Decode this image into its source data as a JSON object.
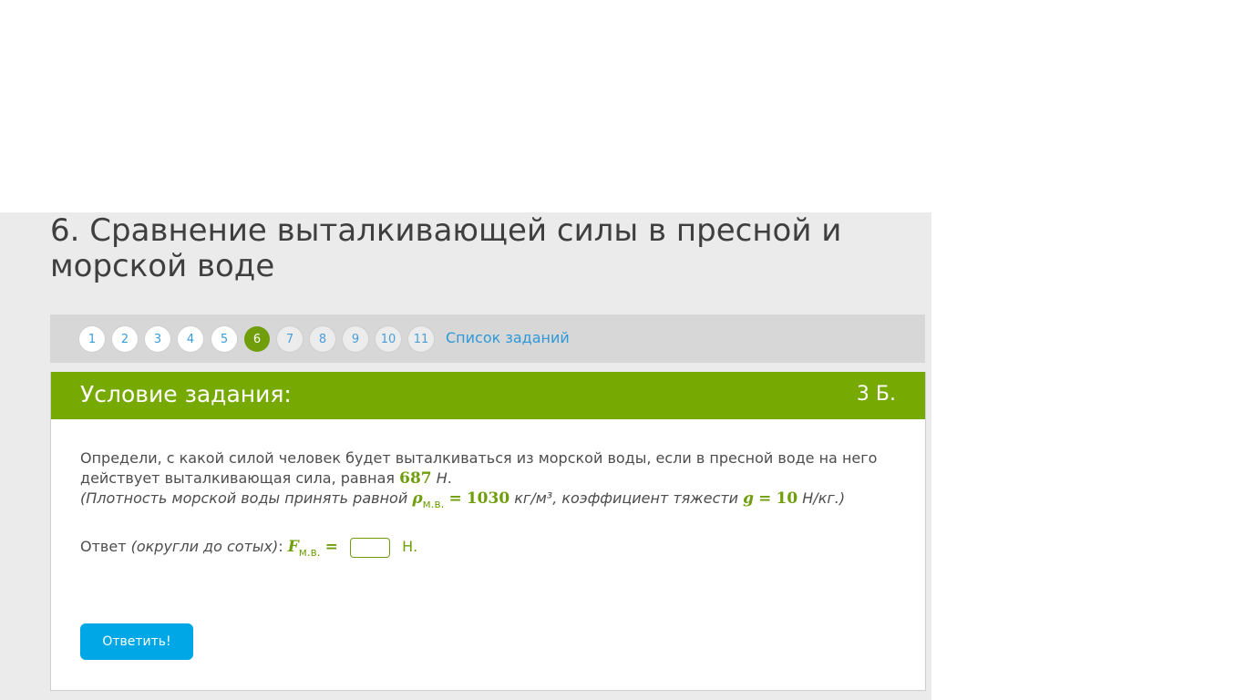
{
  "task": {
    "title": "6. Сравнение выталкивающей силы в пресной и морской воде"
  },
  "nav": {
    "items": [
      {
        "label": "1",
        "state": "done"
      },
      {
        "label": "2",
        "state": "done"
      },
      {
        "label": "3",
        "state": "done"
      },
      {
        "label": "4",
        "state": "done"
      },
      {
        "label": "5",
        "state": "done"
      },
      {
        "label": "6",
        "state": "active"
      },
      {
        "label": "7",
        "state": "future"
      },
      {
        "label": "8",
        "state": "future"
      },
      {
        "label": "9",
        "state": "future"
      },
      {
        "label": "10",
        "state": "future"
      },
      {
        "label": "11",
        "state": "future"
      }
    ],
    "list_link": "Список заданий"
  },
  "card": {
    "header_title": "Условие задания:",
    "points": "3 Б.",
    "problem_text": "Определи, с какой силой человек будет выталкиваться из морской воды, если в пресной воде на него действует выталкивающая сила, равная",
    "force_value": "687",
    "force_unit": "Н",
    "period": ".",
    "hint_open": "(Плотность морской воды принять равной",
    "rho_symbol": "ρ",
    "rho_sub": "м.в.",
    "equals": "=",
    "rho_value": "1030",
    "rho_unit": "кг/м³, коэффициент тяжести",
    "g_symbol": "g",
    "g_value": "10",
    "hint_close": "Н/кг.)",
    "answer_label": "Ответ",
    "answer_hint": "(округли до сотых)",
    "colon": ":",
    "f_symbol": "F",
    "f_sub": "м.в.",
    "answer_value": "",
    "answer_unit": "Н.",
    "submit_label": "Ответить!"
  },
  "colors": {
    "accent_green": "#76aa03",
    "link_blue": "#2e99d9",
    "button_blue": "#00a7e6"
  }
}
